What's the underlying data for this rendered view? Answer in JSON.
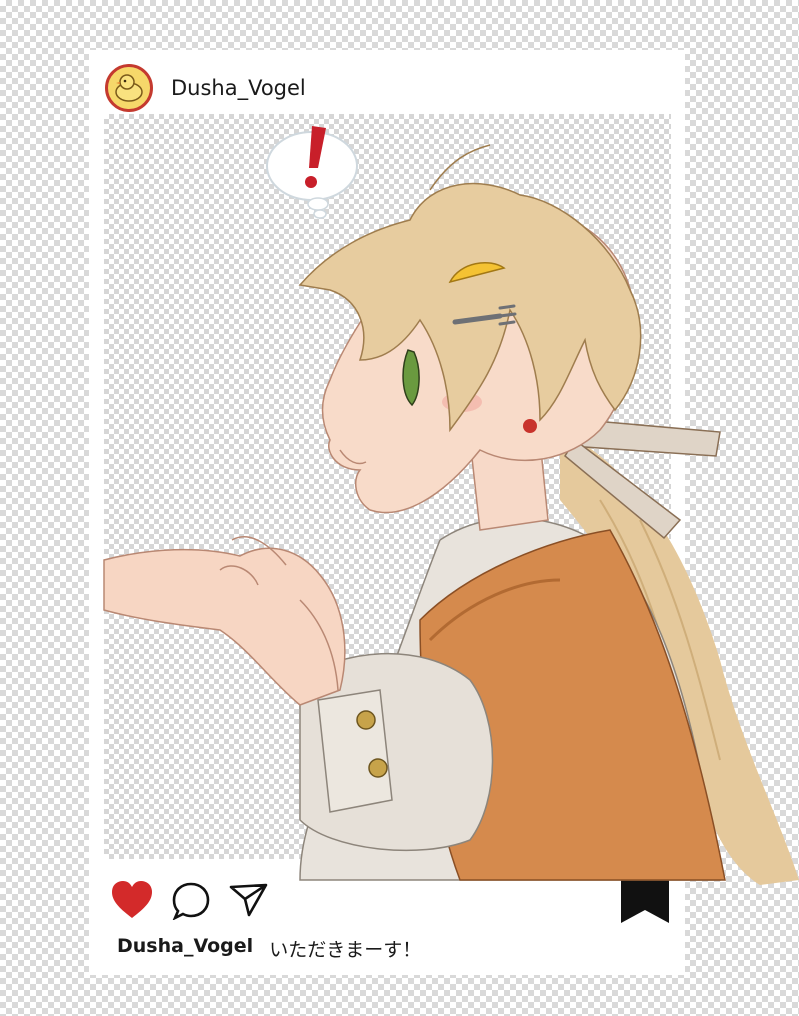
{
  "post": {
    "username": "Dusha_Vogel",
    "caption_user": "Dusha_Vogel",
    "caption_text": "いただきまーす！"
  },
  "colors": {
    "accent_red": "#d32a2a",
    "avatar_ring": "#c43a2f",
    "avatar_fill": "#f6d86a"
  },
  "icons": {
    "avatar": "chick-icon",
    "like": "heart-icon",
    "comment": "speech-bubble-icon",
    "share": "paper-plane-icon",
    "save": "bookmark-icon",
    "reaction": "exclamation-icon"
  }
}
